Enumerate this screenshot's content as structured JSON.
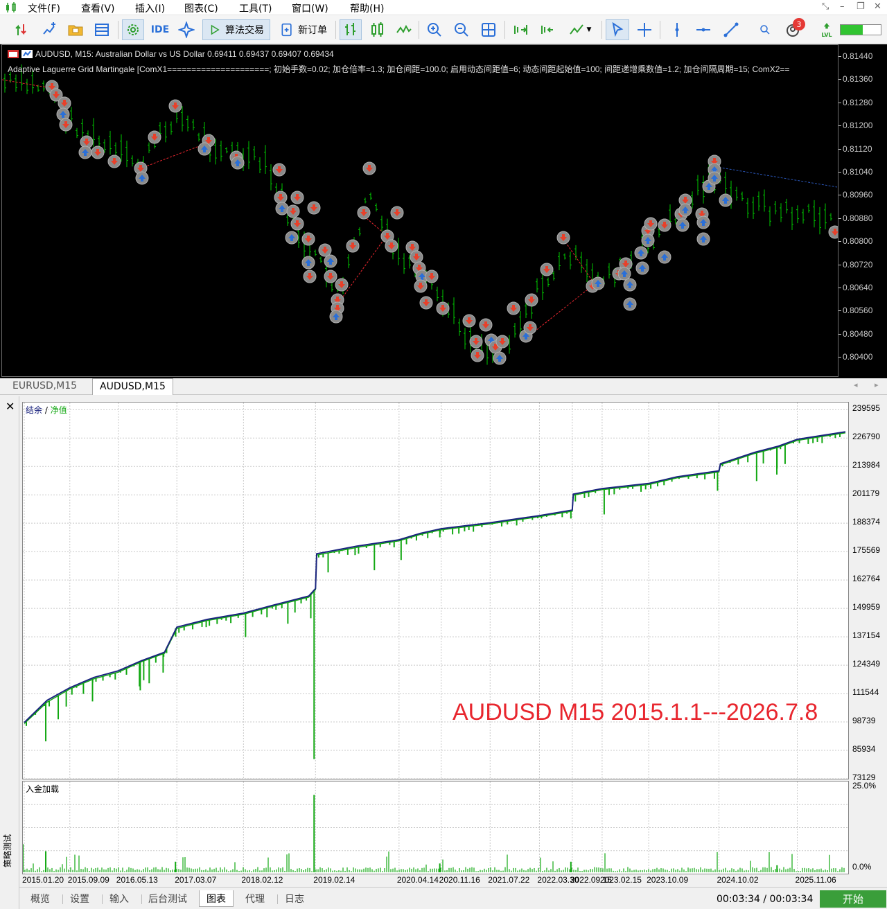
{
  "menu": {
    "items": [
      "文件(F)",
      "查看(V)",
      "插入(I)",
      "图表(C)",
      "工具(T)",
      "窗口(W)",
      "帮助(H)"
    ]
  },
  "toolbar": {
    "algo_trading_label": "算法交易",
    "new_order_label": "新订单",
    "ide_label": "IDE",
    "notification_count": "3",
    "level_label": "LVL"
  },
  "chart": {
    "title": "AUDUSD, M15:  Australian Dollar vs US Dollar  0.69411 0.69437 0.69407 0.69434",
    "ea_line": "Adaptive Laguerre Grid Martingale [ComX1=====================; 初始手数=0.02; 加仓倍率=1.3; 加仓间距=100.0; 启用动态间距值=6; 动态间距起始值=100; 间距递增乘数值=1.2; 加仓间隔周期=15; ComX2==",
    "price_ticks": [
      "0.81440",
      "0.81360",
      "0.81280",
      "0.81200",
      "0.81120",
      "0.81040",
      "0.80960",
      "0.80880",
      "0.80800",
      "0.80720",
      "0.80640",
      "0.80560",
      "0.80480",
      "0.80400"
    ],
    "colors": {
      "background": "#000000",
      "bar": "#00c800",
      "sell_arrow": "#e8402a",
      "buy_arrow": "#2a6fd8",
      "trade_line": "#e8262e"
    }
  },
  "chart_tabs": [
    "EURUSD,M15",
    "AUDUSD,M15"
  ],
  "tester": {
    "legend_balance": "结余",
    "legend_sep": "/",
    "legend_equity": "净值",
    "load_label": "入金加载",
    "watermark": "AUDUSD M15 2015.1.1---2026.7.8",
    "side_label": "策略测试",
    "tabs": [
      "概览",
      "设置",
      "输入",
      "后台测试",
      "图表",
      "代理",
      "日志"
    ],
    "timer": "00:03:34 / 00:03:34",
    "start_label": "开始",
    "colors": {
      "balance": "#1a237e",
      "equity": "#12a812",
      "load": "#12a812"
    }
  },
  "chart_data": [
    {
      "type": "line",
      "series": [
        {
          "name": "结余",
          "values": [
            98500,
            108500,
            114200,
            118800,
            121800,
            126400,
            130200,
            141500,
            145000,
            147800,
            151500,
            155500,
            158900,
            174600,
            178000,
            180900,
            183800,
            185900,
            188600,
            191800,
            194300,
            201500,
            204000,
            206300,
            209300,
            212000,
            215200,
            220300,
            223100,
            226200,
            229600
          ]
        },
        {
          "name": "净值",
          "values": [
            98000,
            107700,
            113600,
            118200,
            121200,
            125900,
            129700,
            140900,
            144500,
            147300,
            151000,
            155000,
            158400,
            174000,
            177400,
            180400,
            183300,
            185400,
            188100,
            191300,
            193800,
            201000,
            203500,
            205800,
            208800,
            211500,
            214700,
            219800,
            222600,
            225700,
            229100
          ]
        }
      ],
      "x": [
        "2015.01.20",
        "2015.05.15",
        "2015.09.09",
        "2016.01.10",
        "2016.05.13",
        "2016.09.10",
        "2017.01.05",
        "2017.03.07",
        "2017.08.10",
        "2018.02.12",
        "2018.07.15",
        "2019.01.10",
        "2019.02.14",
        "2019.02.20",
        "2019.09.10",
        "2020.04.14",
        "2020.08.01",
        "2020.11.16",
        "2021.07.22",
        "2022.03.30",
        "2022.09.15",
        "2022.09.20",
        "2023.02.15",
        "2023.10.09",
        "2024.03.01",
        "2024.10.02",
        "2024.10.10",
        "2025.04.01",
        "2025.08.01",
        "2025.11.06",
        "2026.07.08"
      ],
      "x_ticks": [
        "2015.01.20",
        "2015.09.09",
        "2016.05.13",
        "2017.03.07",
        "2018.02.12",
        "2019.02.14",
        "2020.04.14",
        "2020.11.16",
        "2021.07.22",
        "2022.03.30",
        "2022.09.15",
        "2023.02.15",
        "2023.10.09",
        "2024.10.02",
        "2025.11.06"
      ],
      "y_ticks": [
        "239595",
        "226790",
        "213984",
        "201179",
        "188374",
        "175569",
        "162764",
        "149959",
        "137154",
        "124349",
        "111544",
        "98739",
        "85934",
        "73129"
      ],
      "ylim": [
        73129,
        242800
      ],
      "grid": true,
      "legend": "top-left"
    },
    {
      "type": "bar",
      "name": "入金加载",
      "y_ticks": [
        "25.0%",
        "0.0%"
      ],
      "ylim": [
        0,
        25
      ],
      "grid": true
    }
  ]
}
